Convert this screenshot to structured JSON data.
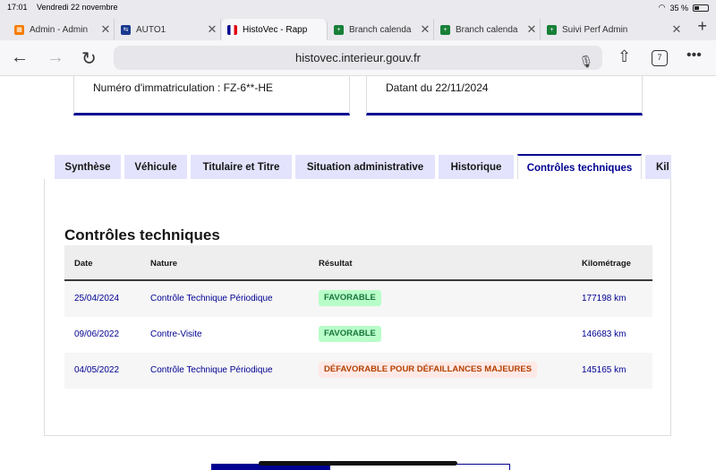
{
  "status_bar": {
    "time": "17:01",
    "date": "Vendredi 22 novembre",
    "battery": "35 %"
  },
  "browser_tabs": [
    {
      "label": "Admin - Admin",
      "favicon": "admin-favicon",
      "color": "#f57c00"
    },
    {
      "label": "AUTO1",
      "favicon": "auto1-favicon",
      "color": "#1a3a8f"
    },
    {
      "label": "HistoVec - Rapp",
      "favicon": "french-flag-favicon",
      "color": "#000091"
    },
    {
      "label": "Branch calenda",
      "favicon": "sheets-favicon",
      "color": "#188038"
    },
    {
      "label": "Branch calenda",
      "favicon": "sheets-favicon",
      "color": "#188038"
    },
    {
      "label": "Suivi Perf Admin",
      "favicon": "sheets-favicon",
      "color": "#188038"
    }
  ],
  "url": "histovec.interieur.gouv.fr",
  "tab_count": "7",
  "cards": {
    "left": "Numéro d'immatriculation : FZ-6**-HE",
    "right": "Datant du 22/11/2024"
  },
  "page_tabs": [
    "Synthèse",
    "Véhicule",
    "Titulaire et Titre",
    "Situation administrative",
    "Historique",
    "Contrôles techniques",
    "Kil"
  ],
  "section_title": "Contrôles techniques",
  "table": {
    "headers": [
      "Date",
      "Nature",
      "Résultat",
      "Kilométrage"
    ],
    "rows": [
      {
        "date": "25/04/2024",
        "nature": "Contrôle Technique Périodique",
        "result": "FAVORABLE",
        "km": "177198 km"
      },
      {
        "date": "09/06/2022",
        "nature": "Contre-Visite",
        "result": "FAVORABLE",
        "km": "146683 km"
      },
      {
        "date": "04/05/2022",
        "nature": "Contrôle Technique Périodique",
        "result": "DÉFAVORABLE POUR DÉFAILLANCES MAJEURES",
        "km": "145165 km"
      }
    ]
  },
  "colors": {
    "accent": "#000091",
    "favorable": "#18753c",
    "defavorable": "#b34000"
  }
}
